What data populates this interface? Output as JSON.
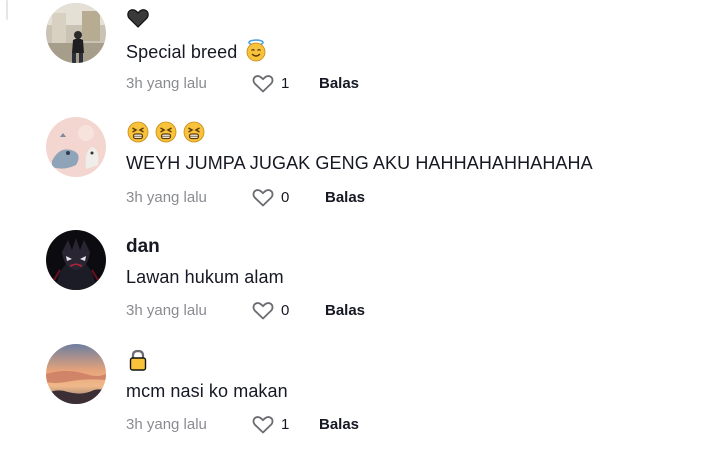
{
  "comments": [
    {
      "text": "Special breed",
      "time": "3h yang lalu",
      "likes": "1",
      "reply_label": "Balas",
      "header_icons": [
        "black-heart-icon"
      ],
      "inline_icon": "smiling-face-with-halo-icon"
    },
    {
      "text": "WEYH JUMPA JUGAK GENG AKU HAHHAHAHHAHAHA",
      "time": "3h yang lalu",
      "likes": "0",
      "reply_label": "Balas",
      "header_icons": [
        "tired-face-icon",
        "tired-face-icon",
        "tired-face-icon"
      ]
    },
    {
      "username": "dan",
      "text": "Lawan hukum alam",
      "time": "3h yang lalu",
      "likes": "0",
      "reply_label": "Balas"
    },
    {
      "text": "mcm nasi ko makan",
      "time": "3h yang lalu",
      "likes": "1",
      "reply_label": "Balas",
      "header_icons": [
        "lock-icon"
      ]
    }
  ],
  "colors": {
    "text_primary": "#161823",
    "text_secondary": "#8a8b91",
    "emoji_yellow": "#f8c23a"
  }
}
